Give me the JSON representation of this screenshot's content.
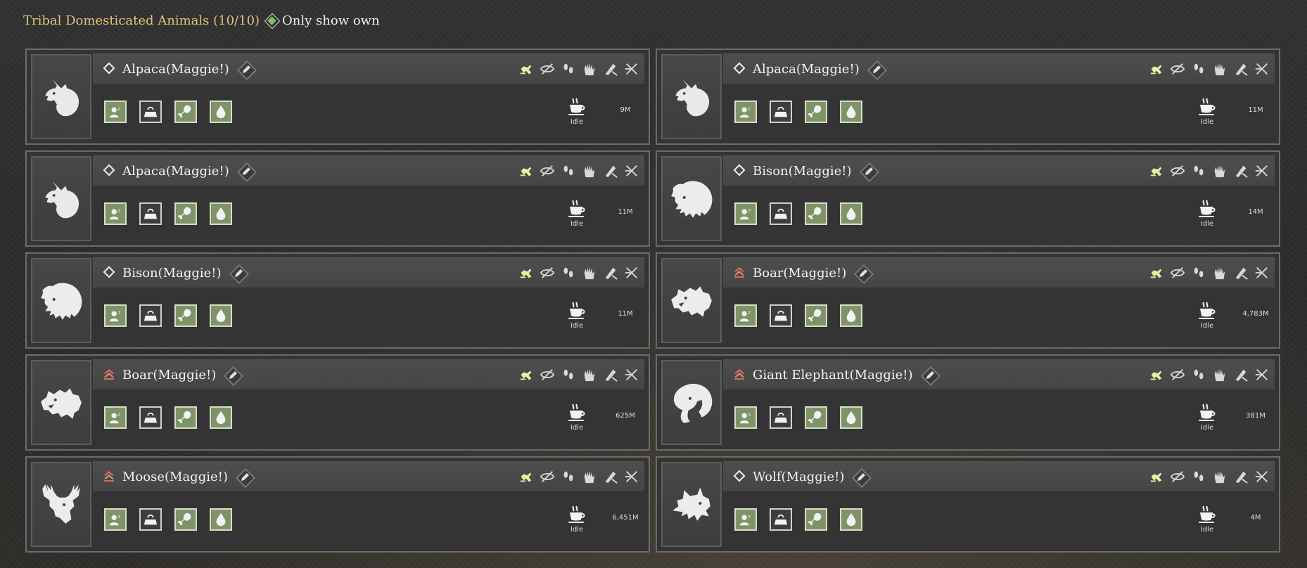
{
  "header": {
    "title": "Tribal Domesticated Animals (10/10)",
    "filter_label": "Only show own",
    "filter_checked": true
  },
  "colors": {
    "title": "#e2c27c",
    "checkbox": "#7fbf5f",
    "stat_fill": "#7e9468",
    "rank_red": "#d96a5a",
    "active_order": "#e6eea0"
  },
  "order_icons": [
    "follow-icon",
    "passive-icon",
    "wander-icon",
    "halt-icon",
    "gather-icon",
    "attack-off-icon"
  ],
  "stat_icons": [
    "rest-icon",
    "weight-icon",
    "food-icon",
    "water-icon"
  ],
  "animals": [
    {
      "name": "Alpaca(Maggie!)",
      "species": "alpaca",
      "rank": "diamond",
      "status": "Idle",
      "weight": "9M"
    },
    {
      "name": "Alpaca(Maggie!)",
      "species": "alpaca",
      "rank": "diamond",
      "status": "Idle",
      "weight": "11M"
    },
    {
      "name": "Alpaca(Maggie!)",
      "species": "alpaca",
      "rank": "diamond",
      "status": "Idle",
      "weight": "11M"
    },
    {
      "name": "Bison(Maggie!)",
      "species": "bison",
      "rank": "diamond",
      "status": "Idle",
      "weight": "14M"
    },
    {
      "name": "Bison(Maggie!)",
      "species": "bison",
      "rank": "diamond",
      "status": "Idle",
      "weight": "11M"
    },
    {
      "name": "Boar(Maggie!)",
      "species": "boar",
      "rank": "chevron",
      "status": "Idle",
      "weight": "4,783M"
    },
    {
      "name": "Boar(Maggie!)",
      "species": "boar",
      "rank": "chevron",
      "status": "Idle",
      "weight": "625M"
    },
    {
      "name": "Giant Elephant(Maggie!)",
      "species": "elephant",
      "rank": "chevron",
      "status": "Idle",
      "weight": "381M"
    },
    {
      "name": "Moose(Maggie!)",
      "species": "moose",
      "rank": "chevron",
      "status": "Idle",
      "weight": "6,451M"
    },
    {
      "name": "Wolf(Maggie!)",
      "species": "wolf",
      "rank": "diamond",
      "status": "Idle",
      "weight": "4M"
    }
  ]
}
